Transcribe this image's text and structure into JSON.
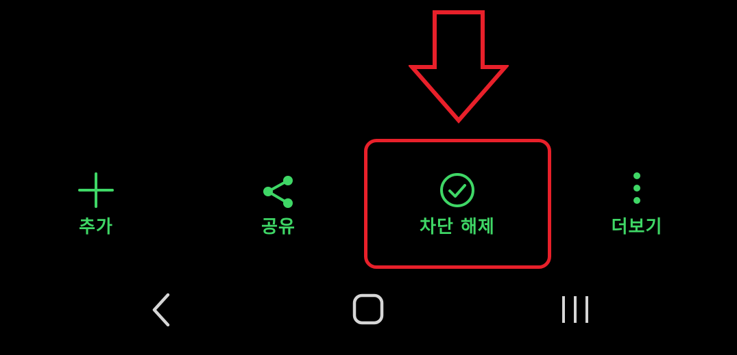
{
  "bottom_actions": [
    {
      "label": "추가",
      "icon": "plus-icon"
    },
    {
      "label": "공유",
      "icon": "share-icon"
    },
    {
      "label": "차단 해제",
      "icon": "check-circle-icon"
    },
    {
      "label": "더보기",
      "icon": "more-vertical-icon"
    }
  ],
  "navigation_bar": {
    "back_icon": "back-chevron-icon",
    "home_icon": "home-rounded-square-icon",
    "recents_icon": "recent-apps-icon"
  },
  "colors": {
    "background": "#000000",
    "accent_green": "#3fd766",
    "annotation_red": "#e8202a",
    "nav_gray": "#d6d6d6"
  }
}
